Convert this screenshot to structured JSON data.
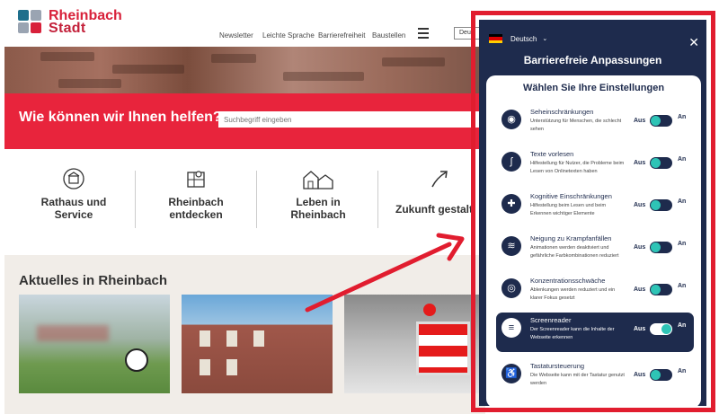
{
  "site": {
    "logo": {
      "line1": "Rheinbach",
      "line2": "Stadt"
    },
    "nav": [
      "Newsletter",
      "Leichte Sprache",
      "Barrierefreiheit",
      "Baustellen"
    ],
    "lang_mini": "Deu",
    "search": {
      "title": "Wie können wir Ihnen helfen?",
      "placeholder": "Suchbegriff eingeben"
    },
    "services": [
      {
        "label": "Rathaus und Service",
        "icon": "town-hall-icon"
      },
      {
        "label": "Rheinbach entdecken",
        "icon": "map-icon"
      },
      {
        "label": "Leben in Rheinbach",
        "icon": "houses-icon"
      },
      {
        "label": "Zukunft gestalt",
        "icon": "arrow-up-icon"
      }
    ],
    "news": {
      "title": "Aktuelles in Rheinbach"
    }
  },
  "panel": {
    "language": "Deutsch",
    "title": "Barrierefreie Anpassungen",
    "subtitle": "Wählen Sie Ihre Einstellungen",
    "off_label": "Aus",
    "on_label": "An",
    "options": [
      {
        "name": "Seheinschränkungen",
        "desc": "Unterstützung für Menschen, die schlecht sehen",
        "icon": "eye-icon",
        "glyph": "◉",
        "active": false
      },
      {
        "name": "Texte vorlesen",
        "desc": "Hilfestellung für Nutzer, die Probleme beim Lesen von Onlinetexten haben",
        "icon": "ear-icon",
        "glyph": "ʃ",
        "active": false
      },
      {
        "name": "Kognitive Einschränkungen",
        "desc": "Hilfestellung beim Lesen und beim Erkennen wichtiger Elemente",
        "icon": "puzzle-icon",
        "glyph": "✚",
        "active": false
      },
      {
        "name": "Neigung zu Krampfanfällen",
        "desc": "Animationen werden deaktiviert und gefährliche Farbkombinationen reduziert",
        "icon": "seizure-icon",
        "glyph": "≋",
        "active": false
      },
      {
        "name": "Konzentrationsschwäche",
        "desc": "Ablenkungen werden reduziert und ein klarer Fokus gesetzt",
        "icon": "focus-icon",
        "glyph": "◎",
        "active": false
      },
      {
        "name": "Screenreader",
        "desc": "Der Screenreader kann die Inhalte der Webseite erkennen",
        "icon": "screenreader-icon",
        "glyph": "≡",
        "active": true
      },
      {
        "name": "Tastatursteuerung",
        "desc": "Die Webseite kann mit der Tastatur genutzt werden",
        "icon": "wheelchair-icon",
        "glyph": "♿",
        "active": false
      }
    ]
  },
  "colors": {
    "brand_red": "#e8243c",
    "panel_navy": "#1e2b4d",
    "toggle_teal": "#2ec4b6",
    "highlight_frame": "#e11d2f"
  }
}
